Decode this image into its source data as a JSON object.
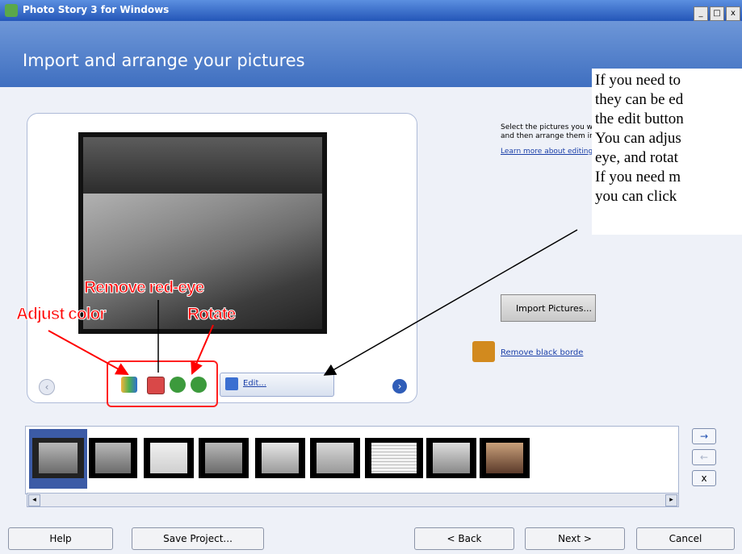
{
  "window": {
    "title": "Photo Story 3 for Windows",
    "controls": [
      "_",
      "□",
      "x"
    ]
  },
  "header": {
    "title": "Import and arrange your pictures"
  },
  "right_panel": {
    "instruction_line1": "Select the pictures you want",
    "instruction_line2": "and then arrange them in ord",
    "learn_link": "Learn more about editing you",
    "import_button": "Import Pictures...",
    "remove_borders_link": "Remove black borde"
  },
  "preview": {
    "edit_button": "Edit..."
  },
  "annotations": {
    "remove_red_eye": "Remove red-eye",
    "adjust_color": "Adjust color",
    "rotate": "Rotate"
  },
  "callout": {
    "lines": [
      "If you need to",
      "they can be ed",
      "the edit button",
      "You can adjus",
      "eye, and rotat",
      "If you need m",
      "you can click"
    ]
  },
  "filmstrip": {
    "thumbnail_count": 9,
    "side_buttons": [
      "→",
      "←",
      "x"
    ]
  },
  "footer": {
    "help": "Help",
    "save_project": "Save Project...",
    "back": "< Back",
    "next": "Next >",
    "cancel": "Cancel"
  },
  "colors": {
    "header_blue": "#3f6fc0",
    "annotation_red": "#ff0000",
    "link_blue": "#1a3fa8"
  }
}
